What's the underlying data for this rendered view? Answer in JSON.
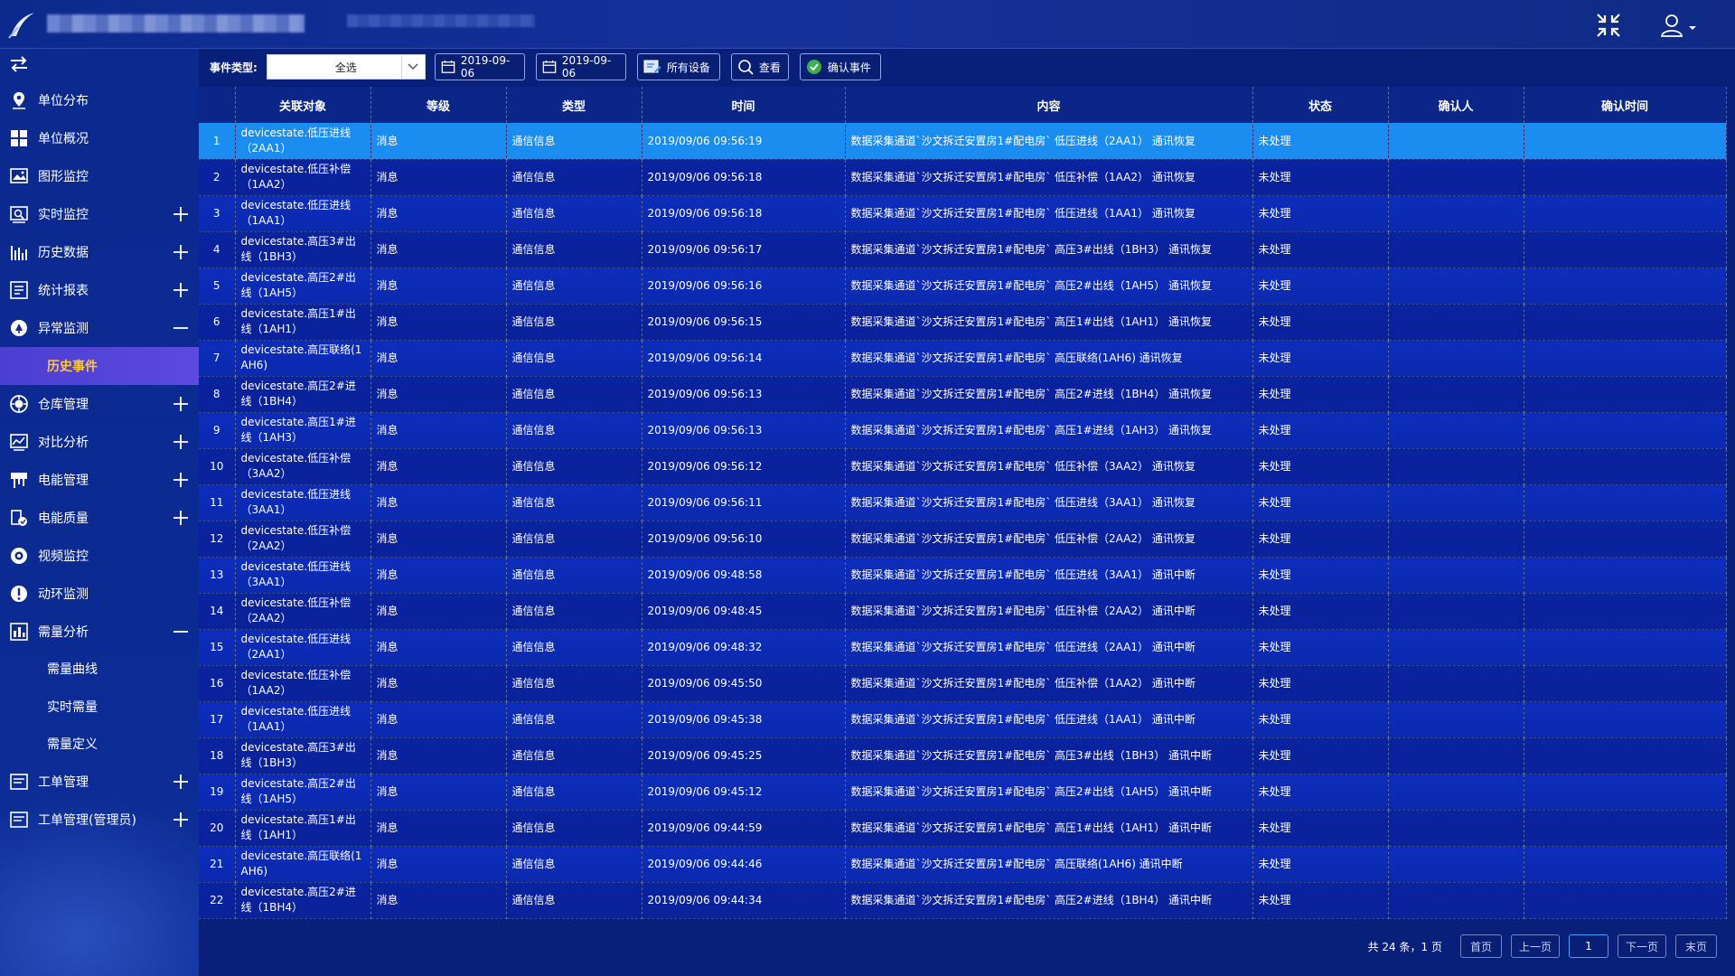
{
  "sidebar": {
    "items": [
      {
        "label": "单位分布",
        "icon": "map-pin-icon",
        "expand": "none"
      },
      {
        "label": "单位概况",
        "icon": "grid-icon",
        "expand": "none"
      },
      {
        "label": "图形监控",
        "icon": "monitor-image-icon",
        "expand": "none"
      },
      {
        "label": "实时监控",
        "icon": "realtime-monitor-icon",
        "expand": "plus"
      },
      {
        "label": "历史数据",
        "icon": "history-bars-icon",
        "expand": "plus"
      },
      {
        "label": "统计报表",
        "icon": "report-icon",
        "expand": "plus"
      },
      {
        "label": "异常监测",
        "icon": "alert-circle-icon",
        "expand": "minus"
      },
      {
        "label": "历史事件",
        "sub": true,
        "active": true
      },
      {
        "label": "仓库管理",
        "icon": "warehouse-icon",
        "expand": "plus"
      },
      {
        "label": "对比分析",
        "icon": "compare-chart-icon",
        "expand": "plus"
      },
      {
        "label": "电能管理",
        "icon": "energy-icon",
        "expand": "plus"
      },
      {
        "label": "电能质量",
        "icon": "quality-icon",
        "expand": "plus"
      },
      {
        "label": "视频监控",
        "icon": "camera-icon",
        "expand": "none"
      },
      {
        "label": "动环监测",
        "icon": "exclamation-icon",
        "expand": "none"
      },
      {
        "label": "需量分析",
        "icon": "demand-icon",
        "expand": "minus"
      },
      {
        "label": "需量曲线",
        "sub": true
      },
      {
        "label": "实时需量",
        "sub": true
      },
      {
        "label": "需量定义",
        "sub": true
      },
      {
        "label": "工单管理",
        "icon": "work-order-icon",
        "expand": "plus"
      },
      {
        "label": "工单管理(管理员)",
        "icon": "work-order-admin-icon",
        "expand": "plus"
      }
    ]
  },
  "toolbar": {
    "event_type_label": "事件类型:",
    "event_type_value": "全选",
    "start_date": "2019-09-06",
    "end_date": "2019-09-06",
    "devices_label": "所有设备",
    "view_label": "查看",
    "confirm_label": "确认事件"
  },
  "table": {
    "columns": [
      "",
      "关联对象",
      "等级",
      "类型",
      "时间",
      "内容",
      "状态",
      "确认人",
      "确认时间"
    ],
    "selected_index": 0,
    "rows": [
      {
        "no": "1",
        "obj": "devicestate.低压进线（2AA1）",
        "level": "消息",
        "type": "通信信息",
        "time": "2019/09/06 09:56:19",
        "content": "数据采集通道`沙文拆迁安置房1#配电房` 低压进线（2AA1） 通讯恢复",
        "status": "未处理"
      },
      {
        "no": "2",
        "obj": "devicestate.低压补偿（1AA2）",
        "level": "消息",
        "type": "通信信息",
        "time": "2019/09/06 09:56:18",
        "content": "数据采集通道`沙文拆迁安置房1#配电房` 低压补偿（1AA2） 通讯恢复",
        "status": "未处理"
      },
      {
        "no": "3",
        "obj": "devicestate.低压进线（1AA1）",
        "level": "消息",
        "type": "通信信息",
        "time": "2019/09/06 09:56:18",
        "content": "数据采集通道`沙文拆迁安置房1#配电房` 低压进线（1AA1） 通讯恢复",
        "status": "未处理"
      },
      {
        "no": "4",
        "obj": "devicestate.高压3#出线（1BH3）",
        "level": "消息",
        "type": "通信信息",
        "time": "2019/09/06 09:56:17",
        "content": "数据采集通道`沙文拆迁安置房1#配电房` 高压3#出线（1BH3） 通讯恢复",
        "status": "未处理"
      },
      {
        "no": "5",
        "obj": "devicestate.高压2#出线（1AH5）",
        "level": "消息",
        "type": "通信信息",
        "time": "2019/09/06 09:56:16",
        "content": "数据采集通道`沙文拆迁安置房1#配电房` 高压2#出线（1AH5） 通讯恢复",
        "status": "未处理"
      },
      {
        "no": "6",
        "obj": "devicestate.高压1#出线（1AH1）",
        "level": "消息",
        "type": "通信信息",
        "time": "2019/09/06 09:56:15",
        "content": "数据采集通道`沙文拆迁安置房1#配电房` 高压1#出线（1AH1） 通讯恢复",
        "status": "未处理"
      },
      {
        "no": "7",
        "obj": "devicestate.高压联络(1AH6)",
        "level": "消息",
        "type": "通信信息",
        "time": "2019/09/06 09:56:14",
        "content": "数据采集通道`沙文拆迁安置房1#配电房` 高压联络(1AH6) 通讯恢复",
        "status": "未处理"
      },
      {
        "no": "8",
        "obj": "devicestate.高压2#进线（1BH4）",
        "level": "消息",
        "type": "通信信息",
        "time": "2019/09/06 09:56:13",
        "content": "数据采集通道`沙文拆迁安置房1#配电房` 高压2#进线（1BH4） 通讯恢复",
        "status": "未处理"
      },
      {
        "no": "9",
        "obj": "devicestate.高压1#进线（1AH3）",
        "level": "消息",
        "type": "通信信息",
        "time": "2019/09/06 09:56:13",
        "content": "数据采集通道`沙文拆迁安置房1#配电房` 高压1#进线（1AH3） 通讯恢复",
        "status": "未处理"
      },
      {
        "no": "10",
        "obj": "devicestate.低压补偿（3AA2）",
        "level": "消息",
        "type": "通信信息",
        "time": "2019/09/06 09:56:12",
        "content": "数据采集通道`沙文拆迁安置房1#配电房` 低压补偿（3AA2） 通讯恢复",
        "status": "未处理"
      },
      {
        "no": "11",
        "obj": "devicestate.低压进线（3AA1）",
        "level": "消息",
        "type": "通信信息",
        "time": "2019/09/06 09:56:11",
        "content": "数据采集通道`沙文拆迁安置房1#配电房` 低压进线（3AA1） 通讯恢复",
        "status": "未处理"
      },
      {
        "no": "12",
        "obj": "devicestate.低压补偿（2AA2）",
        "level": "消息",
        "type": "通信信息",
        "time": "2019/09/06 09:56:10",
        "content": "数据采集通道`沙文拆迁安置房1#配电房` 低压补偿（2AA2） 通讯恢复",
        "status": "未处理"
      },
      {
        "no": "13",
        "obj": "devicestate.低压进线（3AA1）",
        "level": "消息",
        "type": "通信信息",
        "time": "2019/09/06 09:48:58",
        "content": "数据采集通道`沙文拆迁安置房1#配电房` 低压进线（3AA1） 通讯中断",
        "status": "未处理"
      },
      {
        "no": "14",
        "obj": "devicestate.低压补偿（2AA2）",
        "level": "消息",
        "type": "通信信息",
        "time": "2019/09/06 09:48:45",
        "content": "数据采集通道`沙文拆迁安置房1#配电房` 低压补偿（2AA2） 通讯中断",
        "status": "未处理"
      },
      {
        "no": "15",
        "obj": "devicestate.低压进线（2AA1）",
        "level": "消息",
        "type": "通信信息",
        "time": "2019/09/06 09:48:32",
        "content": "数据采集通道`沙文拆迁安置房1#配电房` 低压进线（2AA1） 通讯中断",
        "status": "未处理"
      },
      {
        "no": "16",
        "obj": "devicestate.低压补偿（1AA2）",
        "level": "消息",
        "type": "通信信息",
        "time": "2019/09/06 09:45:50",
        "content": "数据采集通道`沙文拆迁安置房1#配电房` 低压补偿（1AA2） 通讯中断",
        "status": "未处理"
      },
      {
        "no": "17",
        "obj": "devicestate.低压进线（1AA1）",
        "level": "消息",
        "type": "通信信息",
        "time": "2019/09/06 09:45:38",
        "content": "数据采集通道`沙文拆迁安置房1#配电房` 低压进线（1AA1） 通讯中断",
        "status": "未处理"
      },
      {
        "no": "18",
        "obj": "devicestate.高压3#出线（1BH3）",
        "level": "消息",
        "type": "通信信息",
        "time": "2019/09/06 09:45:25",
        "content": "数据采集通道`沙文拆迁安置房1#配电房` 高压3#出线（1BH3） 通讯中断",
        "status": "未处理"
      },
      {
        "no": "19",
        "obj": "devicestate.高压2#出线（1AH5）",
        "level": "消息",
        "type": "通信信息",
        "time": "2019/09/06 09:45:12",
        "content": "数据采集通道`沙文拆迁安置房1#配电房` 高压2#出线（1AH5） 通讯中断",
        "status": "未处理"
      },
      {
        "no": "20",
        "obj": "devicestate.高压1#出线（1AH1）",
        "level": "消息",
        "type": "通信信息",
        "time": "2019/09/06 09:44:59",
        "content": "数据采集通道`沙文拆迁安置房1#配电房` 高压1#出线（1AH1） 通讯中断",
        "status": "未处理"
      },
      {
        "no": "21",
        "obj": "devicestate.高压联络(1AH6)",
        "level": "消息",
        "type": "通信信息",
        "time": "2019/09/06 09:44:46",
        "content": "数据采集通道`沙文拆迁安置房1#配电房` 高压联络(1AH6) 通讯中断",
        "status": "未处理"
      },
      {
        "no": "22",
        "obj": "devicestate.高压2#进线（1BH4）",
        "level": "消息",
        "type": "通信信息",
        "time": "2019/09/06 09:44:34",
        "content": "数据采集通道`沙文拆迁安置房1#配电房` 高压2#进线（1BH4） 通讯中断",
        "status": "未处理"
      }
    ]
  },
  "pager": {
    "info": "共 24 条，1 页",
    "first": "首页",
    "prev": "上一页",
    "current": "1",
    "next": "下一页",
    "last": "末页"
  },
  "colors": {
    "accent": "#1b8cf0",
    "active_menu": "#5d49e0",
    "active_text": "#ffc83a"
  }
}
